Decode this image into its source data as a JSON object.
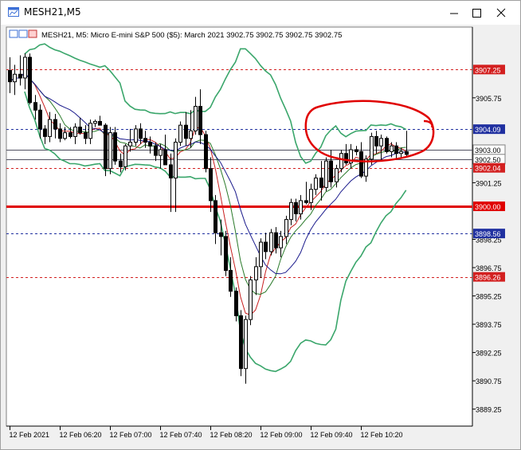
{
  "window": {
    "title": "MESH21,M5"
  },
  "chart_header": {
    "text": "MESH21, M5:  Micro E-mini S&P 500 ($5): March 2021  3902.75 3902.75 3902.75 3902.75"
  },
  "chart_data": {
    "type": "candlestick",
    "symbol": "MESH21",
    "timeframe": "M5",
    "y_ticks": [
      3889.25,
      3890.75,
      3892.25,
      3893.75,
      3895.25,
      3896.75,
      3898.25,
      3901.25,
      3905.75
    ],
    "ylim": [
      3888.35,
      3909.5
    ],
    "x_ticks": [
      "12 Feb 2021",
      "12 Feb 06:20",
      "12 Feb 07:00",
      "12 Feb 07:40",
      "12 Feb 08:20",
      "12 Feb 09:00",
      "12 Feb 09:40",
      "12 Feb 10:20"
    ],
    "price_levels": [
      {
        "value": 3907.25,
        "label": "3907.25",
        "style": "dashed",
        "color": "#d32020"
      },
      {
        "value": 3904.09,
        "label": "3904.09",
        "style": "dashed",
        "color": "#2030a0"
      },
      {
        "value": 3903.0,
        "label": "3903.00",
        "style": "solid",
        "color": "#505060"
      },
      {
        "value": 3902.5,
        "label": "3902.50",
        "style": "solid",
        "color": "#505060"
      },
      {
        "value": 3902.04,
        "label": "3902.04",
        "style": "dashed",
        "color": "#d32020"
      },
      {
        "value": 3900.0,
        "label": "3900.00",
        "style": "thick",
        "color": "#e00000"
      },
      {
        "value": 3898.56,
        "label": "3898.56",
        "style": "dashed",
        "color": "#2030a0"
      },
      {
        "value": 3896.26,
        "label": "3896.26",
        "style": "dashed",
        "color": "#d32020"
      }
    ],
    "candles": [
      [
        3907.2,
        3907.9,
        3906.0,
        3906.6
      ],
      [
        3906.6,
        3907.5,
        3905.9,
        3907.0
      ],
      [
        3907.0,
        3908.0,
        3906.4,
        3906.8
      ],
      [
        3906.8,
        3908.1,
        3906.2,
        3907.9
      ],
      [
        3907.9,
        3908.1,
        3905.4,
        3905.5
      ],
      [
        3905.5,
        3905.9,
        3904.6,
        3905.1
      ],
      [
        3905.1,
        3905.4,
        3903.6,
        3904.1
      ],
      [
        3904.1,
        3904.3,
        3903.3,
        3903.7
      ],
      [
        3903.7,
        3905.0,
        3903.4,
        3904.6
      ],
      [
        3904.6,
        3904.9,
        3903.6,
        3904.1
      ],
      [
        3904.1,
        3904.4,
        3903.4,
        3903.6
      ],
      [
        3903.6,
        3904.2,
        3903.5,
        3903.9
      ],
      [
        3903.9,
        3904.2,
        3903.6,
        3903.7
      ],
      [
        3903.7,
        3904.4,
        3903.3,
        3904.2
      ],
      [
        3904.2,
        3904.7,
        3903.8,
        3903.9
      ],
      [
        3903.9,
        3904.3,
        3903.3,
        3903.6
      ],
      [
        3903.6,
        3904.6,
        3903.3,
        3904.4
      ],
      [
        3904.4,
        3904.6,
        3904.2,
        3904.5
      ],
      [
        3904.5,
        3904.8,
        3904.3,
        3904.3
      ],
      [
        3904.3,
        3904.4,
        3901.6,
        3902.0
      ],
      [
        3902.0,
        3904.2,
        3901.7,
        3903.9
      ],
      [
        3903.9,
        3904.2,
        3902.2,
        3902.4
      ],
      [
        3902.4,
        3902.8,
        3901.8,
        3902.1
      ],
      [
        3902.1,
        3903.3,
        3901.9,
        3903.2
      ],
      [
        3903.2,
        3904.1,
        3902.9,
        3903.4
      ],
      [
        3903.4,
        3904.3,
        3903.2,
        3904.1
      ],
      [
        3904.1,
        3904.4,
        3903.3,
        3903.6
      ],
      [
        3903.6,
        3904.0,
        3903.1,
        3903.4
      ],
      [
        3903.4,
        3903.7,
        3902.8,
        3903.2
      ],
      [
        3903.2,
        3903.4,
        3902.4,
        3902.7
      ],
      [
        3902.7,
        3903.3,
        3902.0,
        3903.0
      ],
      [
        3903.0,
        3903.8,
        3902.6,
        3902.2
      ],
      [
        3902.2,
        3902.8,
        3899.7,
        3901.5
      ],
      [
        3901.5,
        3903.6,
        3899.7,
        3903.4
      ],
      [
        3903.4,
        3904.5,
        3903.2,
        3904.3
      ],
      [
        3904.3,
        3905.0,
        3903.2,
        3903.6
      ],
      [
        3903.6,
        3905.1,
        3903.1,
        3904.0
      ],
      [
        3904.0,
        3905.8,
        3903.8,
        3905.3
      ],
      [
        3905.3,
        3906.2,
        3903.3,
        3903.8
      ],
      [
        3903.8,
        3904.0,
        3901.8,
        3902.0
      ],
      [
        3902.0,
        3902.6,
        3899.7,
        3900.3
      ],
      [
        3900.3,
        3900.6,
        3898.0,
        3898.6
      ],
      [
        3898.6,
        3899.3,
        3897.4,
        3898.4
      ],
      [
        3898.4,
        3898.7,
        3896.3,
        3896.6
      ],
      [
        3896.6,
        3897.3,
        3895.2,
        3895.5
      ],
      [
        3895.5,
        3895.7,
        3893.9,
        3894.2
      ],
      [
        3894.2,
        3894.5,
        3891.0,
        3891.4
      ],
      [
        3891.4,
        3894.2,
        3890.6,
        3894.0
      ],
      [
        3894.0,
        3896.3,
        3893.7,
        3896.1
      ],
      [
        3896.1,
        3897.3,
        3895.3,
        3896.8
      ],
      [
        3896.8,
        3898.3,
        3896.2,
        3898.1
      ],
      [
        3898.1,
        3898.6,
        3897.2,
        3897.6
      ],
      [
        3897.6,
        3898.8,
        3897.4,
        3898.6
      ],
      [
        3898.6,
        3898.9,
        3897.5,
        3897.8
      ],
      [
        3897.8,
        3898.7,
        3897.3,
        3898.4
      ],
      [
        3898.4,
        3899.5,
        3898.0,
        3899.3
      ],
      [
        3899.3,
        3900.4,
        3899.0,
        3900.2
      ],
      [
        3900.2,
        3900.4,
        3899.2,
        3899.6
      ],
      [
        3899.6,
        3900.6,
        3899.3,
        3900.3
      ],
      [
        3900.3,
        3901.3,
        3900.1,
        3900.2
      ],
      [
        3900.2,
        3901.2,
        3899.8,
        3900.9
      ],
      [
        3900.9,
        3901.7,
        3900.6,
        3901.5
      ],
      [
        3901.5,
        3902.4,
        3900.3,
        3901.0
      ],
      [
        3901.0,
        3902.6,
        3900.8,
        3902.4
      ],
      [
        3902.4,
        3903.0,
        3901.0,
        3901.3
      ],
      [
        3901.3,
        3902.2,
        3901.0,
        3902.0
      ],
      [
        3902.0,
        3903.0,
        3901.8,
        3902.8
      ],
      [
        3902.8,
        3903.3,
        3902.2,
        3902.3
      ],
      [
        3902.3,
        3903.3,
        3902.0,
        3903.0
      ],
      [
        3903.0,
        3903.2,
        3902.7,
        3902.9
      ],
      [
        3902.9,
        3903.4,
        3901.5,
        3901.6
      ],
      [
        3901.6,
        3902.7,
        3901.3,
        3902.5
      ],
      [
        3902.5,
        3903.9,
        3902.2,
        3903.7
      ],
      [
        3903.7,
        3904.0,
        3902.8,
        3903.2
      ],
      [
        3903.2,
        3903.8,
        3902.4,
        3903.6
      ],
      [
        3903.6,
        3903.7,
        3902.8,
        3902.9
      ],
      [
        3902.9,
        3903.4,
        3902.6,
        3903.2
      ],
      [
        3903.2,
        3903.4,
        3902.5,
        3902.8
      ],
      [
        3902.8,
        3903.1,
        3902.6,
        3902.9
      ],
      [
        3902.9,
        3904.0,
        3902.6,
        3902.75
      ]
    ],
    "line_colors": {
      "bollinger": "#3aa66b",
      "ma_fast": "#c81e1e",
      "ma_mid": "#2a7a2a",
      "ma_slow": "#1a1a8c",
      "annotation": "#e00000"
    },
    "annotation": "hand-drawn red circle around recent candles"
  }
}
